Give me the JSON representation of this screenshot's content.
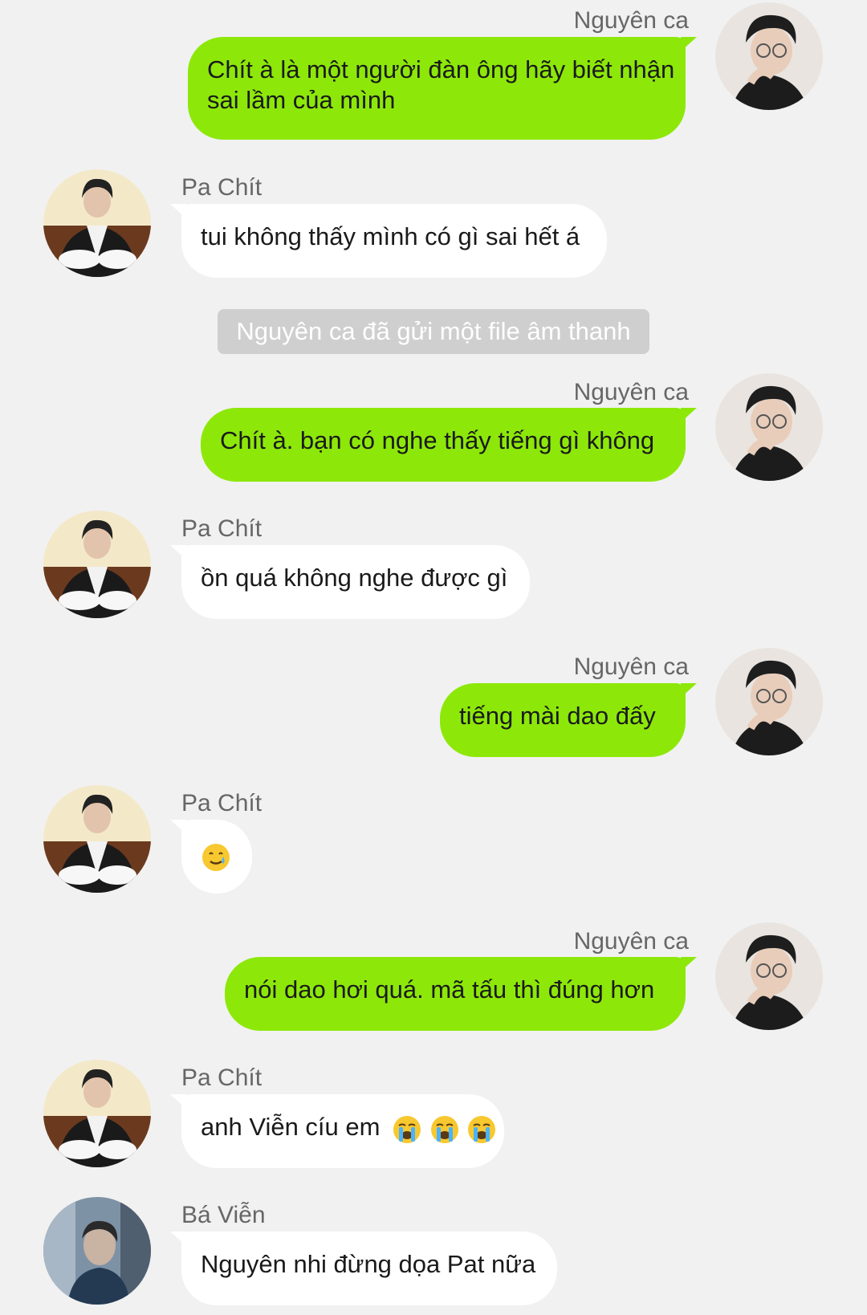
{
  "system_notice": "Nguyên ca đã gửi một file âm thanh",
  "messages": [
    {
      "sender": "Nguyên ca",
      "lines": [
        "Chít à là một người đàn ông hãy biết nhận",
        "sai lầm của mình"
      ]
    },
    {
      "sender": "Pa Chít",
      "text": "tui không thấy mình có gì sai hết á"
    },
    {
      "sender": "Nguyên ca",
      "text": "Chít à. bạn có nghe thấy tiếng gì không"
    },
    {
      "sender": "Pa Chít",
      "text": "ồn quá không nghe được gì"
    },
    {
      "sender": "Nguyên ca",
      "text": "tiếng mài dao đấy"
    },
    {
      "sender": "Pa Chít",
      "emoji": "smiling-face-with-tear"
    },
    {
      "sender": "Nguyên ca",
      "text": "nói dao hơi quá. mã tấu thì đúng hơn"
    },
    {
      "sender": "Pa Chít",
      "text": "anh Viễn cíu em",
      "emoji": "loudly-crying-face x3"
    },
    {
      "sender": "Bá Viễn",
      "text": "Nguyên nhi đừng dọa Pat nữa"
    }
  ],
  "colors": {
    "background": "#f1f1f1",
    "outgoing_bubble": "#8de80a",
    "incoming_bubble": "#ffffff",
    "system_pill": "#cfcfcf"
  }
}
